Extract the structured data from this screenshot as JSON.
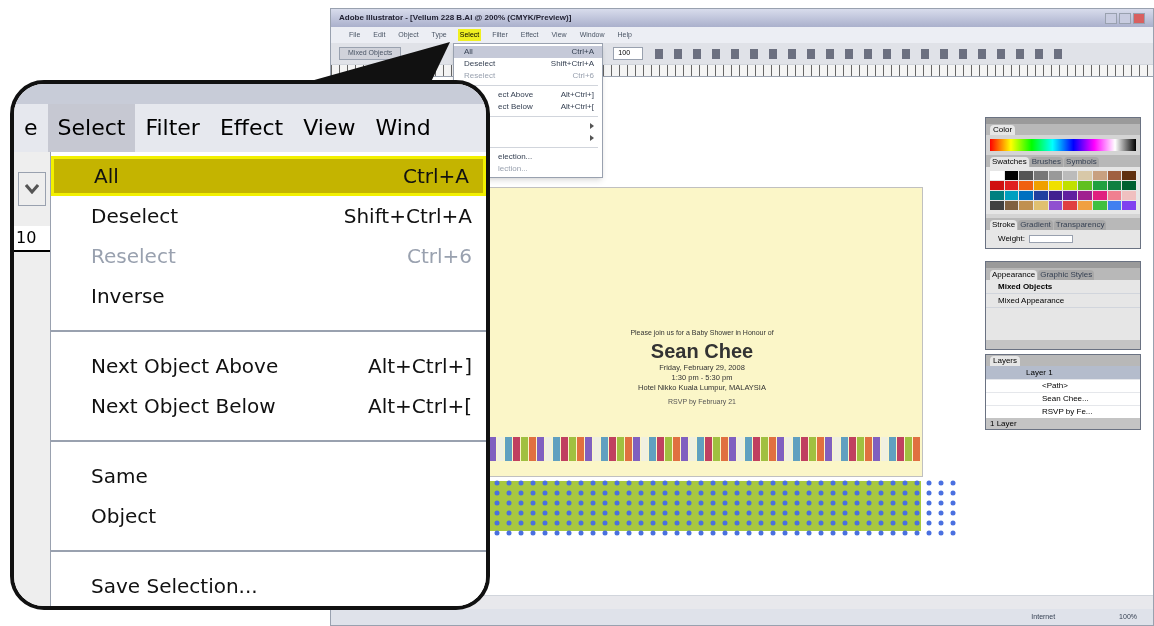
{
  "window": {
    "title": "Adobe Illustrator - [Vellum 228 B.AI @ 200% (CMYK/Preview)]",
    "menus": [
      {
        "label": "File",
        "selected": false
      },
      {
        "label": "Edit",
        "selected": false
      },
      {
        "label": "Object",
        "selected": false
      },
      {
        "label": "Type",
        "selected": false
      },
      {
        "label": "Select",
        "selected": true
      },
      {
        "label": "Filter",
        "selected": false
      },
      {
        "label": "Effect",
        "selected": false
      },
      {
        "label": "View",
        "selected": false
      },
      {
        "label": "Window",
        "selected": false
      },
      {
        "label": "Help",
        "selected": false
      }
    ],
    "control_bar": {
      "selection": "Mixed Objects",
      "opacity": "100"
    },
    "select_menu": [
      {
        "kind": "item",
        "label": "All",
        "shortcut": "Ctrl+A",
        "selected": true,
        "disabled": false
      },
      {
        "kind": "item",
        "label": "Deselect",
        "shortcut": "Shift+Ctrl+A",
        "selected": false,
        "disabled": false
      },
      {
        "kind": "item",
        "label": "Reselect",
        "shortcut": "Ctrl+6",
        "selected": false,
        "disabled": true
      },
      {
        "kind": "separator"
      },
      {
        "kind": "partial",
        "label": "ect Above",
        "shortcut": "Alt+Ctrl+]",
        "selected": false,
        "disabled": false
      },
      {
        "kind": "partial",
        "label": "ect Below",
        "shortcut": "Alt+Ctrl+[",
        "selected": false,
        "disabled": false
      },
      {
        "kind": "separator"
      },
      {
        "kind": "submenu",
        "selected": false,
        "disabled": false
      },
      {
        "kind": "submenu",
        "selected": false,
        "disabled": false
      },
      {
        "kind": "separator"
      },
      {
        "kind": "partial",
        "label": "election...",
        "selected": false,
        "disabled": false
      },
      {
        "kind": "partial",
        "label": "lection...",
        "selected": false,
        "disabled": true
      }
    ],
    "artboard": [
      {
        "kind": "intro",
        "text": "Please join us for a Baby Shower in Honour of"
      },
      {
        "kind": "name",
        "text": "Sean Chee"
      },
      {
        "kind": "detail",
        "text": "Friday, February 29, 2008"
      },
      {
        "kind": "detail",
        "text": "1:30 pm - 5:30 pm"
      },
      {
        "kind": "detail",
        "text": "Hotel Nikko Kuala Lumpur, MALAYSIA"
      },
      {
        "kind": "small",
        "text": "RSVP by February 21"
      }
    ],
    "color_panel": {
      "tab": "Color"
    },
    "swatches_panel": {
      "tabs": [
        {
          "label": "Swatches",
          "selected": true
        },
        {
          "label": "Brushes",
          "selected": false
        },
        {
          "label": "Symbols",
          "selected": false
        }
      ]
    },
    "stroke_panel": {
      "tabs": [
        {
          "label": "Stroke",
          "selected": true
        },
        {
          "label": "Gradient",
          "selected": false
        },
        {
          "label": "Transparency",
          "selected": false
        }
      ],
      "weight_label": "Weight:"
    },
    "appearance_panel": {
      "tabs": [
        {
          "label": "Appearance",
          "selected": true
        },
        {
          "label": "Graphic Styles",
          "selected": false
        }
      ],
      "rows": [
        "Mixed Objects",
        "Mixed Appearance"
      ]
    },
    "layers_panel": {
      "tab": "Layers",
      "layers": [
        {
          "name": "Layer 1",
          "selected": true,
          "children": [
            {
              "name": "<Path>",
              "selected": false
            },
            {
              "name": "Sean Chee...",
              "selected": false
            },
            {
              "name": "RSVP by Fe...",
              "selected": false
            }
          ]
        }
      ],
      "footer": "1 Layer"
    },
    "status_bar": {
      "zone": "Internet",
      "zoom": "100%"
    }
  },
  "callout": {
    "menus": [
      {
        "label": "e",
        "selected": false
      },
      {
        "label": "Select",
        "selected": true
      },
      {
        "label": "Filter",
        "selected": false
      },
      {
        "label": "Effect",
        "selected": false
      },
      {
        "label": "View",
        "selected": false
      },
      {
        "label": "Wind",
        "selected": false
      }
    ],
    "ruler_label": "10",
    "items": [
      {
        "kind": "item",
        "label": "All",
        "shortcut": "Ctrl+A",
        "selected": true,
        "disabled": false
      },
      {
        "kind": "item",
        "label": "Deselect",
        "shortcut": "Shift+Ctrl+A",
        "selected": false,
        "disabled": false
      },
      {
        "kind": "item",
        "label": "Reselect",
        "shortcut": "Ctrl+6",
        "selected": false,
        "disabled": true
      },
      {
        "kind": "item",
        "label": "Inverse",
        "selected": false,
        "disabled": false
      },
      {
        "kind": "separator"
      },
      {
        "kind": "item",
        "label": "Next Object Above",
        "shortcut": "Alt+Ctrl+]",
        "selected": false,
        "disabled": false
      },
      {
        "kind": "item",
        "label": "Next Object Below",
        "shortcut": "Alt+Ctrl+[",
        "selected": false,
        "disabled": false
      },
      {
        "kind": "separator"
      },
      {
        "kind": "item",
        "label": "Same",
        "selected": false,
        "disabled": false
      },
      {
        "kind": "item",
        "label": "Object",
        "selected": false,
        "disabled": false
      },
      {
        "kind": "separator"
      },
      {
        "kind": "item",
        "label": "Save Selection...",
        "selected": false,
        "disabled": false
      }
    ]
  }
}
